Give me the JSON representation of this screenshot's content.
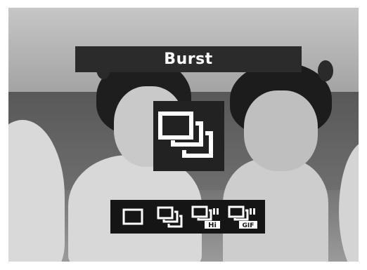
{
  "osd": {
    "title": "Burst",
    "selected_mode": "burst",
    "modes": [
      {
        "id": "single",
        "icon": "single-shot-icon"
      },
      {
        "id": "burst",
        "icon": "burst-icon"
      },
      {
        "id": "burst-hi",
        "icon": "burst-hi-icon",
        "badge": "Hi"
      },
      {
        "id": "burst-gif",
        "icon": "burst-gif-icon",
        "badge": "GIF"
      }
    ]
  },
  "colors": {
    "osd_background": "#2b2b2b",
    "osd_text": "#ffffff",
    "icon_stroke": "#ffffff"
  }
}
